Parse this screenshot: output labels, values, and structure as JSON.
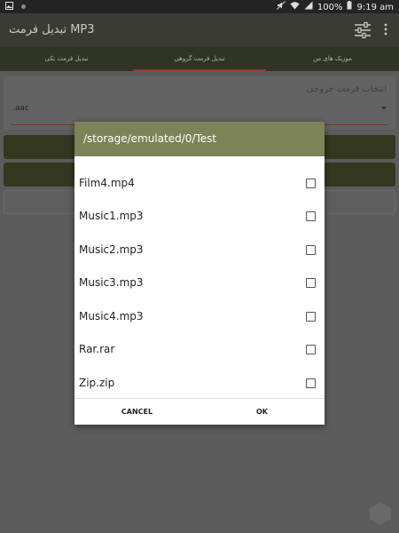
{
  "status_bar": {
    "left_icons": [
      "gallery-icon",
      "notification-icon"
    ],
    "right_icons": [
      "mute-icon",
      "wifi-icon",
      "signal-icon"
    ],
    "battery": "100%",
    "time": "9:19 am"
  },
  "app_bar": {
    "title": "تبدیل فرمت MP3",
    "icons": [
      "equalizer-icon",
      "overflow-menu-icon"
    ]
  },
  "tabs": [
    {
      "label": "موزیک های من"
    },
    {
      "label": "تبدیل فرمت گروهی",
      "selected": true
    },
    {
      "label": "تبدیل فرمت تکی"
    }
  ],
  "format_card": {
    "label": "انتخاب فرمت خروجی",
    "value": ".aac"
  },
  "dialog": {
    "title": "/storage/emulated/0/Test",
    "files": [
      {
        "name": "Film4.mp4",
        "checked": false
      },
      {
        "name": "Music1.mp3",
        "checked": false
      },
      {
        "name": "Music2.mp3",
        "checked": false
      },
      {
        "name": "Music3.mp3",
        "checked": false
      },
      {
        "name": "Music4.mp3",
        "checked": false
      },
      {
        "name": "Rar.rar",
        "checked": false
      },
      {
        "name": "Zip.zip",
        "checked": false
      }
    ],
    "cancel_label": "CANCEL",
    "ok_label": "OK"
  },
  "colors": {
    "dialog_header": "#7b8357",
    "tab_indicator": "#8e3a2b",
    "app_bar": "#3a3c33"
  }
}
